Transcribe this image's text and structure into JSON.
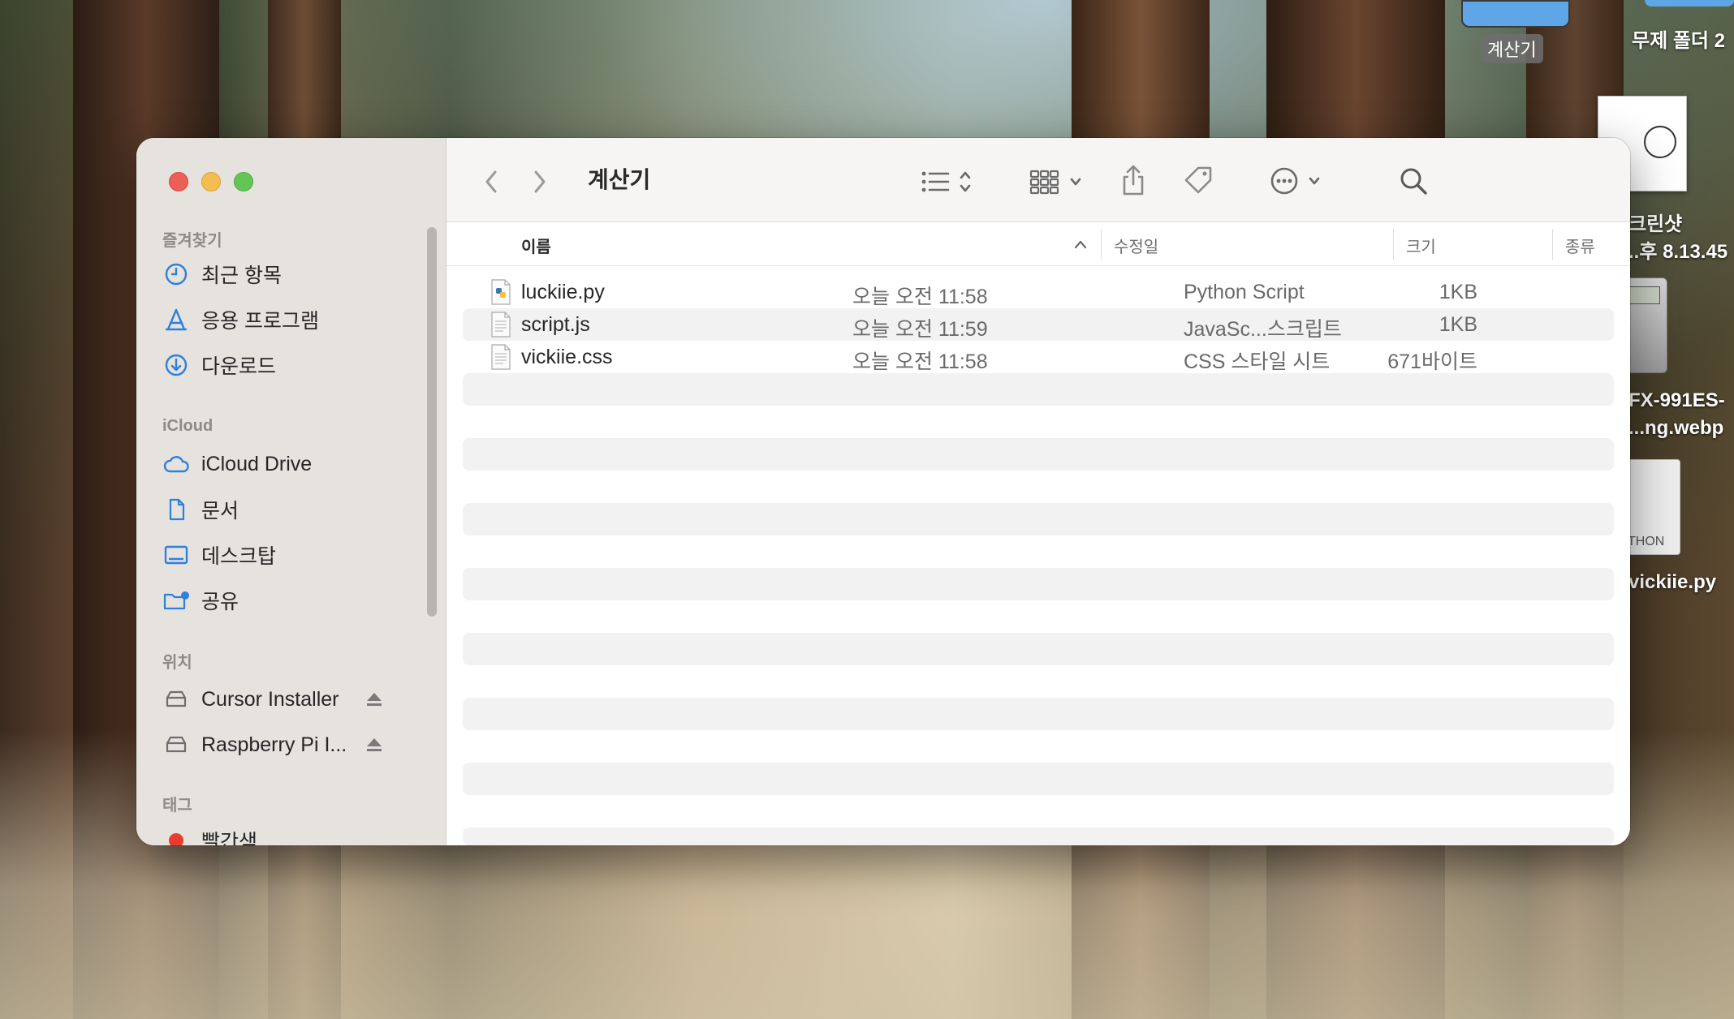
{
  "desktop": {
    "items": [
      {
        "label": "계산기",
        "style": "badge"
      },
      {
        "label": "무제 폴더 2"
      },
      {
        "label": "크린샷"
      },
      {
        "label": "..후 8.13.45"
      },
      {
        "label": "FX-991ES-"
      },
      {
        "label": "...ng.webp"
      },
      {
        "label": "vickiie.py"
      },
      {
        "label": "THON"
      }
    ]
  },
  "window": {
    "title": "계산기",
    "sidebar": {
      "sections": [
        {
          "header": "즐겨찾기",
          "items": [
            {
              "label": "최근 항목",
              "icon": "clock-icon"
            },
            {
              "label": "응용 프로그램",
              "icon": "applications-icon"
            },
            {
              "label": "다운로드",
              "icon": "download-icon"
            }
          ]
        },
        {
          "header": "iCloud",
          "items": [
            {
              "label": "iCloud Drive",
              "icon": "cloud-icon"
            },
            {
              "label": "문서",
              "icon": "document-icon"
            },
            {
              "label": "데스크탑",
              "icon": "desktop-icon"
            },
            {
              "label": "공유",
              "icon": "shared-folder-icon"
            }
          ]
        },
        {
          "header": "위치",
          "items": [
            {
              "label": "Cursor Installer",
              "icon": "drive-icon"
            },
            {
              "label": "Raspberry Pi I...",
              "icon": "drive-icon"
            }
          ]
        },
        {
          "header": "태그",
          "items": [
            {
              "label": "빨간색",
              "icon": "tag-red-icon",
              "color": "#eb3b30"
            }
          ]
        }
      ]
    },
    "columns": {
      "name": "이름",
      "modified": "수정일",
      "size": "크기",
      "kind": "종류"
    },
    "files": [
      {
        "name": "luckiie.py",
        "modified": "오늘 오전 11:58",
        "size": "1KB",
        "kind": "Python Script",
        "icon": "python-file-icon"
      },
      {
        "name": "script.js",
        "modified": "오늘 오전 11:59",
        "size": "1KB",
        "kind": "JavaSc...스크립트",
        "icon": "js-file-icon"
      },
      {
        "name": "vickiie.css",
        "modified": "오늘 오전 11:58",
        "size": "671바이트",
        "kind": "CSS 스타일 시트",
        "icon": "css-file-icon"
      }
    ]
  },
  "colors": {
    "accent": "#2f7fdc",
    "close": "#ec5f57",
    "minimize": "#f4bd4f",
    "zoom": "#62c655"
  }
}
